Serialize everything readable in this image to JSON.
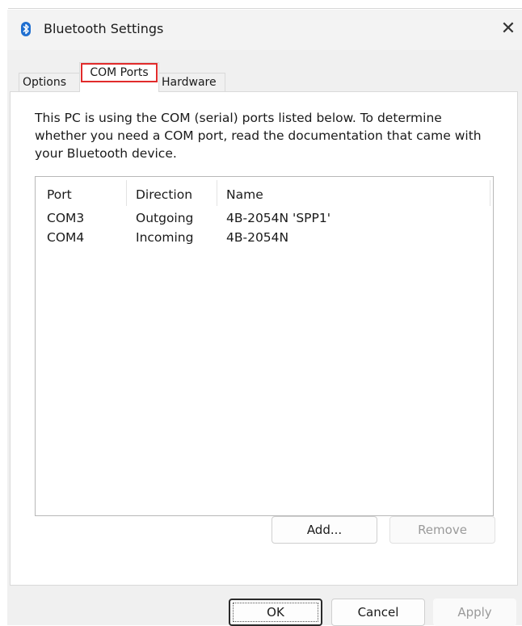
{
  "window": {
    "title": "Bluetooth Settings",
    "close_glyph": "✕",
    "accent": "#1f6fd0",
    "highlight": "#e12b2b"
  },
  "tabs": [
    {
      "label": "Options",
      "selected": false
    },
    {
      "label": "COM Ports",
      "selected": true
    },
    {
      "label": "Hardware",
      "selected": false
    }
  ],
  "description": "This PC is using the COM (serial) ports listed below. To determine whether you need a COM port, read the documentation that came with your Bluetooth device.",
  "list": {
    "headers": {
      "port": "Port",
      "direction": "Direction",
      "name": "Name"
    },
    "rows": [
      {
        "port": "COM3",
        "direction": "Outgoing",
        "name": "4B-2054N 'SPP1'"
      },
      {
        "port": "COM4",
        "direction": "Incoming",
        "name": "4B-2054N"
      }
    ]
  },
  "buttons": {
    "add": "Add...",
    "remove": "Remove",
    "ok": "OK",
    "cancel": "Cancel",
    "apply": "Apply"
  }
}
